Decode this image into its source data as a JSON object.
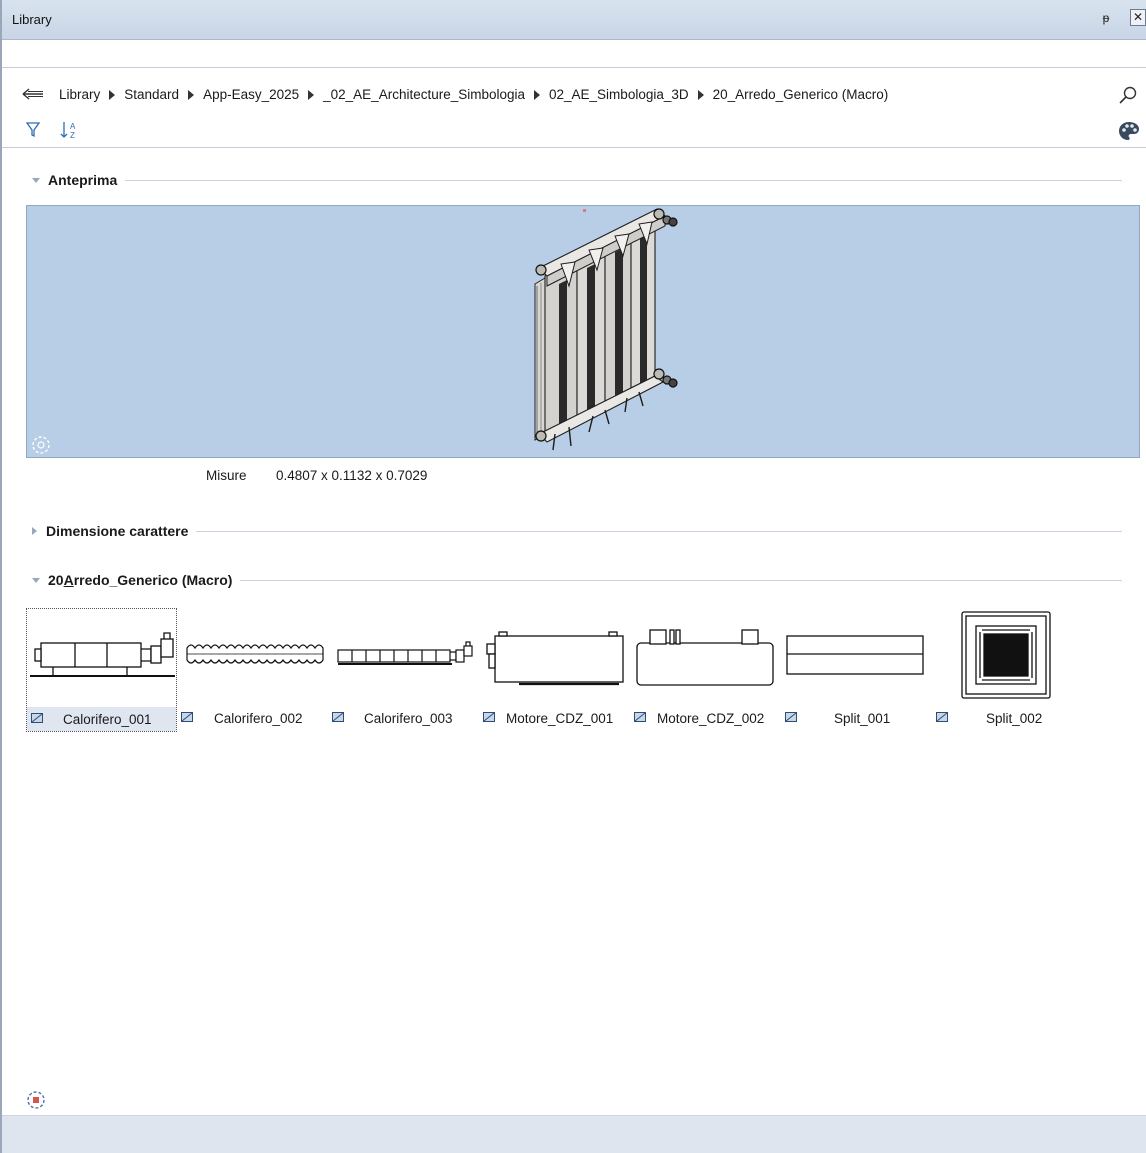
{
  "window": {
    "title": "Library"
  },
  "breadcrumb": {
    "items": [
      "Library",
      "Standard",
      "App-Easy_2025",
      "_02_AE_Architecture_Simbologia",
      "02_AE_Simbologia_3D",
      "20_Arredo_Generico (Macro)"
    ]
  },
  "icons": {
    "back": "back-arrow-icon",
    "search": "search-icon",
    "filter": "filter-icon",
    "sort": "sort-az-icon",
    "palette": "palette-icon",
    "pin": "pin-icon",
    "close": "close-icon"
  },
  "sections": {
    "preview": {
      "label": "Anteprima",
      "expanded": true
    },
    "font_size": {
      "label": "Dimensione carattere",
      "expanded": false
    },
    "folder": {
      "label": "20Arredo_Generico (Macro)",
      "mnemonic_index": 2,
      "expanded": true
    }
  },
  "preview": {
    "dims_label": "Misure",
    "dims_value": "0.4807 x 0.1132 x 0.7029",
    "background": "#b7cee6"
  },
  "items": [
    {
      "name": "Calorifero_001",
      "selected": true
    },
    {
      "name": "Calorifero_002",
      "selected": false
    },
    {
      "name": "Calorifero_003",
      "selected": false
    },
    {
      "name": "Motore_CDZ_001",
      "selected": false
    },
    {
      "name": "Motore_CDZ_002",
      "selected": false
    },
    {
      "name": "Split_001",
      "selected": false
    },
    {
      "name": "Split_002",
      "selected": false
    }
  ]
}
